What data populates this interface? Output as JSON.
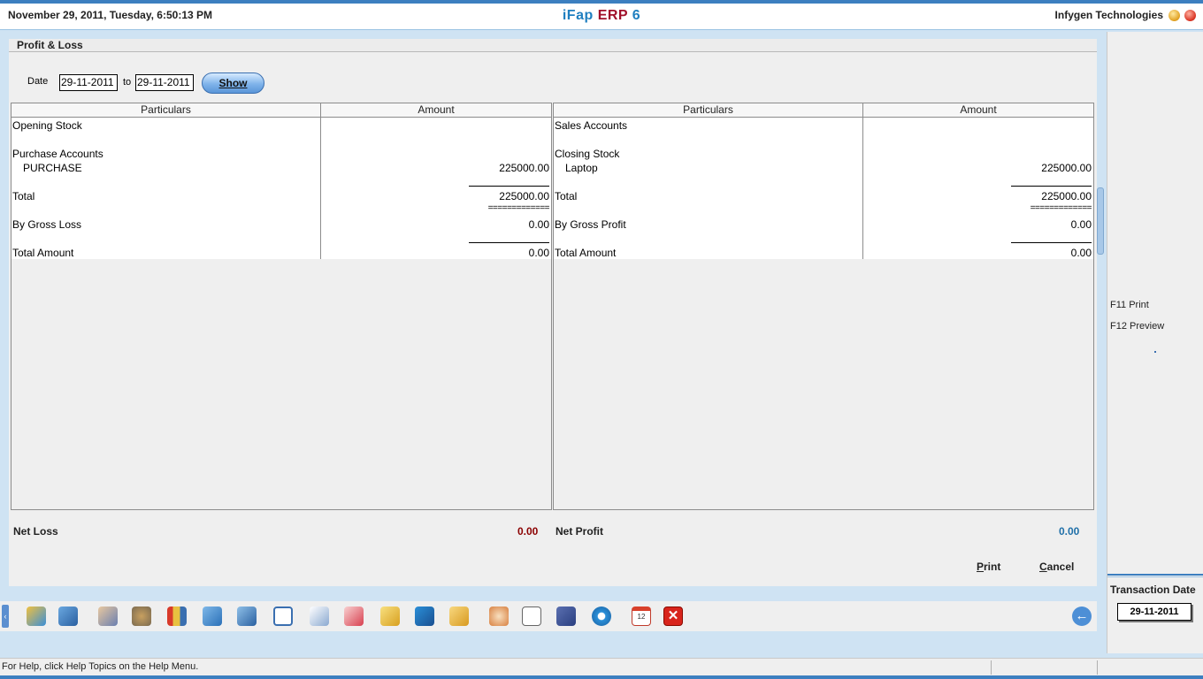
{
  "window": {
    "datetime": "November  29, 2011, Tuesday, 6:50:13 PM",
    "app_name_part1": "iFap",
    "app_name_part2": "ERP",
    "app_name_part3": "6",
    "company": "Infygen Technologies"
  },
  "form": {
    "title": "Profit & Loss",
    "date_label": "Date",
    "date_from": "29-11-2011",
    "to_label": "to",
    "date_to": "29-11-2011",
    "show_button": "Show"
  },
  "left_table": {
    "col_particulars": "Particulars",
    "col_amount": "Amount",
    "opening_stock": "Opening Stock",
    "purchase_accounts": "Purchase Accounts",
    "purchase": "PURCHASE",
    "purchase_amount": "225000.00",
    "total": "Total",
    "total_amount_value": "225000.00",
    "double_rule": "=============",
    "gross_loss": "By Gross Loss",
    "gross_loss_value": "0.00",
    "total_amount": "Total Amount",
    "total_amount_final": "0.00"
  },
  "right_table": {
    "col_particulars": "Particulars",
    "col_amount": "Amount",
    "sales_accounts": "Sales Accounts",
    "closing_stock": "Closing Stock",
    "laptop": "Laptop",
    "laptop_amount": "225000.00",
    "total": "Total",
    "total_amount_value": "225000.00",
    "double_rule": "=============",
    "gross_profit": "By Gross Profit",
    "gross_profit_value": "0.00",
    "total_amount": "Total Amount",
    "total_amount_final": "0.00"
  },
  "net": {
    "loss_label": "Net Loss",
    "loss_value": "0.00",
    "profit_label": "Net Profit",
    "profit_value": "0.00"
  },
  "actions": {
    "print_first": "P",
    "print_rest": "rint",
    "cancel_first": "C",
    "cancel_rest": "ancel"
  },
  "side": {
    "f11": "F11 Print",
    "f12": "F12 Preview",
    "transaction_date_label": "Transaction Date",
    "transaction_date": "29-11-2011"
  },
  "toolbar": {
    "calendar_day": "12",
    "close_glyph": "✕",
    "back_glyph": "←",
    "collapse_glyph": "‹",
    "icons": [
      "accounts-icon",
      "customer-icon",
      "users-icon",
      "settings-gears-icon",
      "books-icon",
      "cart-icon",
      "transfer-icon",
      "window-icon",
      "report-icon",
      "sales-chart-icon",
      "hierarchy-icon",
      "arrows-icon",
      "package-icon",
      "handshake-icon",
      "calculator-sheet-icon",
      "save-disk-icon",
      "config-gear-icon",
      "calendar-icon",
      "close-icon",
      "back-arrow-icon"
    ]
  },
  "colors": {
    "accent": "#3c7fc0",
    "loss": "#8b0000",
    "profit": "#1f6fa8"
  },
  "status": {
    "message": "For Help, click Help Topics on the Help Menu."
  }
}
